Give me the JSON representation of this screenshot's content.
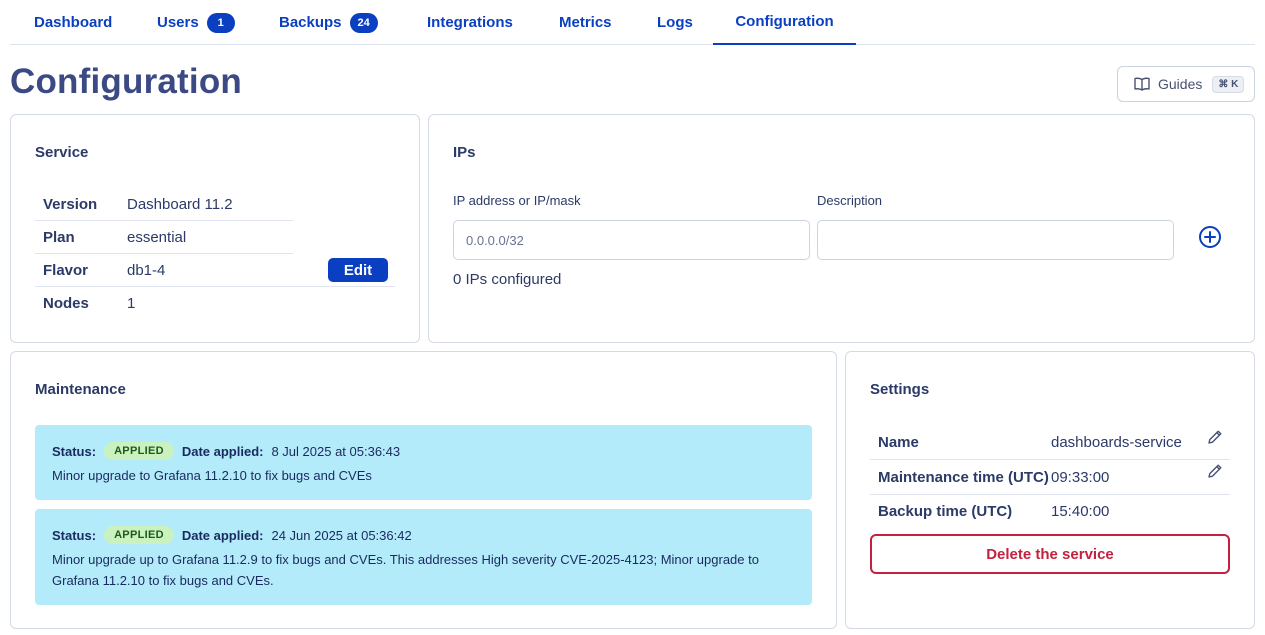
{
  "tabs": [
    {
      "label": "Dashboard"
    },
    {
      "label": "Users",
      "badge": "1"
    },
    {
      "label": "Backups",
      "badge": "24"
    },
    {
      "label": "Integrations"
    },
    {
      "label": "Metrics"
    },
    {
      "label": "Logs"
    },
    {
      "label": "Configuration",
      "active": true
    }
  ],
  "page": {
    "title": "Configuration",
    "guides_label": "Guides",
    "guides_shortcut": "⌘ K"
  },
  "service": {
    "title": "Service",
    "rows": [
      {
        "key": "Version",
        "value": "Dashboard 11.2"
      },
      {
        "key": "Plan",
        "value": "essential"
      },
      {
        "key": "Flavor",
        "value": "db1-4"
      },
      {
        "key": "Nodes",
        "value": "1"
      }
    ],
    "edit_label": "Edit"
  },
  "ips": {
    "title": "IPs",
    "ip_label": "IP address or IP/mask",
    "ip_placeholder": "0.0.0.0/32",
    "desc_label": "Description",
    "desc_value": "",
    "count_text": "0 IPs configured"
  },
  "maintenance": {
    "title": "Maintenance",
    "status_label": "Status:",
    "date_label": "Date applied:",
    "items": [
      {
        "status": "APPLIED",
        "date": "8 Jul 2025 at 05:36:43",
        "description": "Minor upgrade to Grafana 11.2.10 to fix bugs and CVEs"
      },
      {
        "status": "APPLIED",
        "date": "24 Jun 2025 at 05:36:42",
        "description": "Minor upgrade up to Grafana 11.2.9 to fix bugs and CVEs. This addresses High severity CVE-2025-4123; Minor upgrade to Grafana 11.2.10 to fix bugs and CVEs."
      }
    ]
  },
  "settings": {
    "title": "Settings",
    "rows": [
      {
        "key": "Name",
        "value": "dashboards-service",
        "editable": true
      },
      {
        "key": "Maintenance time (UTC)",
        "value": "09:33:00",
        "editable": true
      },
      {
        "key": "Backup time (UTC)",
        "value": "15:40:00",
        "editable": false
      }
    ],
    "delete_label": "Delete the service"
  },
  "colors": {
    "accent": "#0b3fc1",
    "title": "#3b4a85",
    "danger": "#c4203f",
    "maintenance_bg": "#b3ebfb",
    "applied_bg": "#c9f2c0"
  },
  "icons": {
    "guides": "book-open-icon",
    "add_ip": "plus-circle-icon",
    "edit_setting": "pencil-icon"
  }
}
